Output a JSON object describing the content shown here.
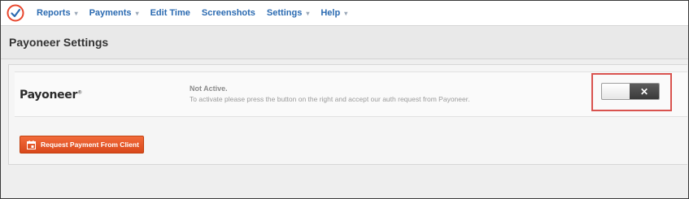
{
  "nav": {
    "items": [
      {
        "label": "Reports",
        "dropdown": true
      },
      {
        "label": "Payments",
        "dropdown": true
      },
      {
        "label": "Edit Time",
        "dropdown": false
      },
      {
        "label": "Screenshots",
        "dropdown": false
      },
      {
        "label": "Settings",
        "dropdown": true
      },
      {
        "label": "Help",
        "dropdown": true
      }
    ],
    "caret": "▾"
  },
  "page": {
    "title": "Payoneer Settings"
  },
  "payoneer": {
    "logo_text": "Payoneer",
    "logo_mark": "®",
    "status_title": "Not Active.",
    "status_description": "To activate please press the button on the right and accept our auth request from Payoneer.",
    "toggle_off_glyph": "✕"
  },
  "actions": {
    "request_payment_label": "Request Payment From Client"
  },
  "colors": {
    "nav_link": "#2a6ab1",
    "accent_button": "#e85a2a",
    "highlight_border": "#d9534f",
    "logo_red": "#e8462d"
  }
}
